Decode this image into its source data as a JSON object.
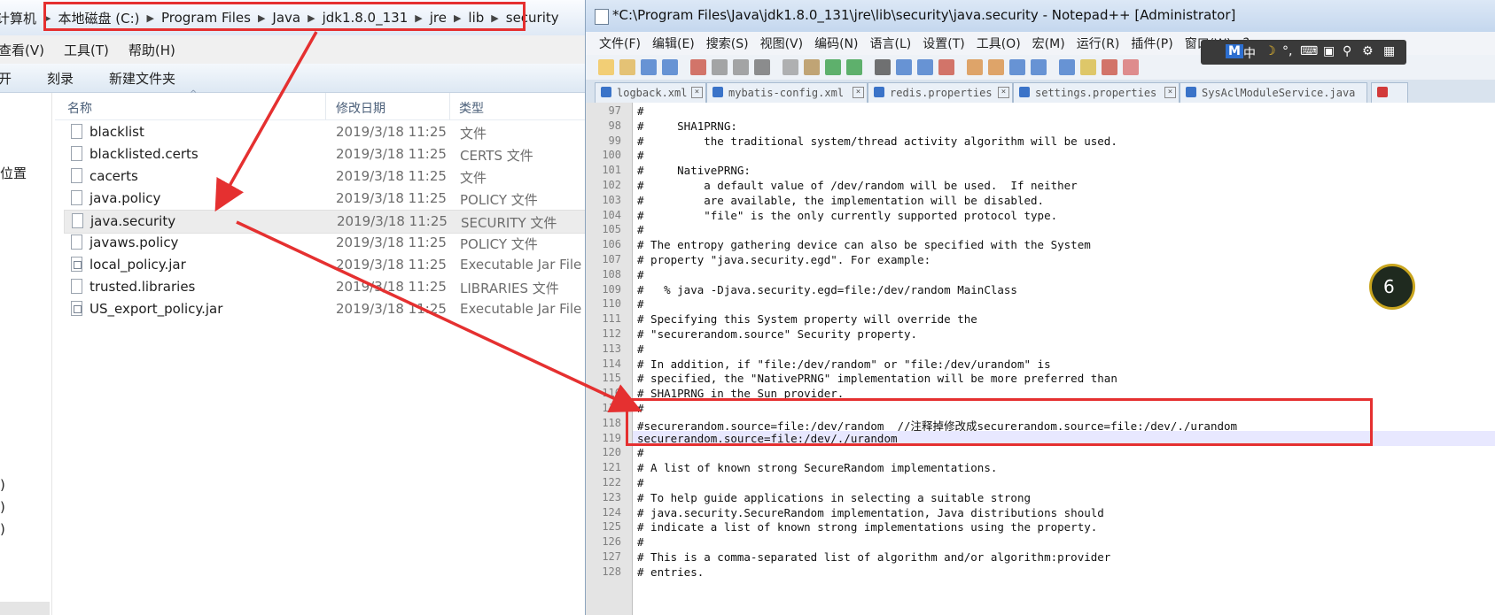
{
  "explorer": {
    "breadcrumbs": [
      "计算机",
      "本地磁盘 (C:)",
      "Program Files",
      "Java",
      "jdk1.8.0_131",
      "jre",
      "lib",
      "security"
    ],
    "menu": [
      "查看(V)",
      "工具(T)",
      "帮助(H)"
    ],
    "toolbar": [
      "开",
      "刻录",
      "新建文件夹"
    ],
    "nav": [
      "位置",
      ")",
      ")",
      ")"
    ],
    "columns": {
      "name": "名称",
      "date": "修改日期",
      "type": "类型"
    },
    "files": [
      {
        "name": "blacklist",
        "date": "2019/3/18 11:25",
        "type": "文件",
        "icon": "file-icon"
      },
      {
        "name": "blacklisted.certs",
        "date": "2019/3/18 11:25",
        "type": "CERTS 文件",
        "icon": "file-icon"
      },
      {
        "name": "cacerts",
        "date": "2019/3/18 11:25",
        "type": "文件",
        "icon": "file-icon"
      },
      {
        "name": "java.policy",
        "date": "2019/3/18 11:25",
        "type": "POLICY 文件",
        "icon": "file-icon"
      },
      {
        "name": "java.security",
        "date": "2019/3/18 11:25",
        "type": "SECURITY 文件",
        "icon": "file-icon",
        "selected": true
      },
      {
        "name": "javaws.policy",
        "date": "2019/3/18 11:25",
        "type": "POLICY 文件",
        "icon": "file-icon"
      },
      {
        "name": "local_policy.jar",
        "date": "2019/3/18 11:25",
        "type": "Executable Jar File",
        "icon": "jar-icon"
      },
      {
        "name": "trusted.libraries",
        "date": "2019/3/18 11:25",
        "type": "LIBRARIES 文件",
        "icon": "file-icon"
      },
      {
        "name": "US_export_policy.jar",
        "date": "2019/3/18 11:25",
        "type": "Executable Jar File",
        "icon": "jar-icon"
      }
    ]
  },
  "npp": {
    "title": "*C:\\Program Files\\Java\\jdk1.8.0_131\\jre\\lib\\security\\java.security - Notepad++ [Administrator]",
    "menu": [
      "文件(F)",
      "编辑(E)",
      "搜索(S)",
      "视图(V)",
      "编码(N)",
      "语言(L)",
      "设置(T)",
      "工具(O)",
      "宏(M)",
      "运行(R)",
      "插件(P)",
      "窗口(W)",
      "?"
    ],
    "tabs": [
      "logback.xml",
      "mybatis-config.xml",
      "redis.properties",
      "settings.properties",
      "SysAclModuleService.java"
    ],
    "lines": [
      {
        "n": "97",
        "t": "#"
      },
      {
        "n": "98",
        "t": "#     SHA1PRNG:"
      },
      {
        "n": "99",
        "t": "#         the traditional system/thread activity algorithm will be used."
      },
      {
        "n": "100",
        "t": "#"
      },
      {
        "n": "101",
        "t": "#     NativePRNG:"
      },
      {
        "n": "102",
        "t": "#         a default value of /dev/random will be used.  If neither"
      },
      {
        "n": "103",
        "t": "#         are available, the implementation will be disabled."
      },
      {
        "n": "104",
        "t": "#         \"file\" is the only currently supported protocol type."
      },
      {
        "n": "105",
        "t": "#"
      },
      {
        "n": "106",
        "t": "# The entropy gathering device can also be specified with the System"
      },
      {
        "n": "107",
        "t": "# property \"java.security.egd\". For example:"
      },
      {
        "n": "108",
        "t": "#"
      },
      {
        "n": "109",
        "t": "#   % java -Djava.security.egd=file:/dev/random MainClass"
      },
      {
        "n": "110",
        "t": "#"
      },
      {
        "n": "111",
        "t": "# Specifying this System property will override the"
      },
      {
        "n": "112",
        "t": "# \"securerandom.source\" Security property."
      },
      {
        "n": "113",
        "t": "#"
      },
      {
        "n": "114",
        "t": "# In addition, if \"file:/dev/random\" or \"file:/dev/urandom\" is"
      },
      {
        "n": "115",
        "t": "# specified, the \"NativePRNG\" implementation will be more preferred than"
      },
      {
        "n": "116",
        "t": "# SHA1PRNG in the Sun provider."
      },
      {
        "n": "117",
        "t": "#"
      },
      {
        "n": "118",
        "t": "#securerandom.source=file:/dev/random  //注释掉修改成securerandom.source=file:/dev/./urandom"
      },
      {
        "n": "119",
        "t": "securerandom.source=file:/dev/./urandom",
        "current": true
      },
      {
        "n": "120",
        "t": "#"
      },
      {
        "n": "121",
        "t": "# A list of known strong SecureRandom implementations."
      },
      {
        "n": "122",
        "t": "#"
      },
      {
        "n": "123",
        "t": "# To help guide applications in selecting a suitable strong"
      },
      {
        "n": "124",
        "t": "# java.security.SecureRandom implementation, Java distributions should"
      },
      {
        "n": "125",
        "t": "# indicate a list of known strong implementations using the property."
      },
      {
        "n": "126",
        "t": "#"
      },
      {
        "n": "127",
        "t": "# This is a comma-separated list of algorithm and/or algorithm:provider"
      },
      {
        "n": "128",
        "t": "# entries."
      }
    ]
  },
  "ime": {
    "labels": [
      "M",
      "中",
      "°,"
    ]
  },
  "bubble": {
    "label": "6"
  },
  "colors": {
    "annotation": "#e53030",
    "accent": "#3a73c8"
  }
}
